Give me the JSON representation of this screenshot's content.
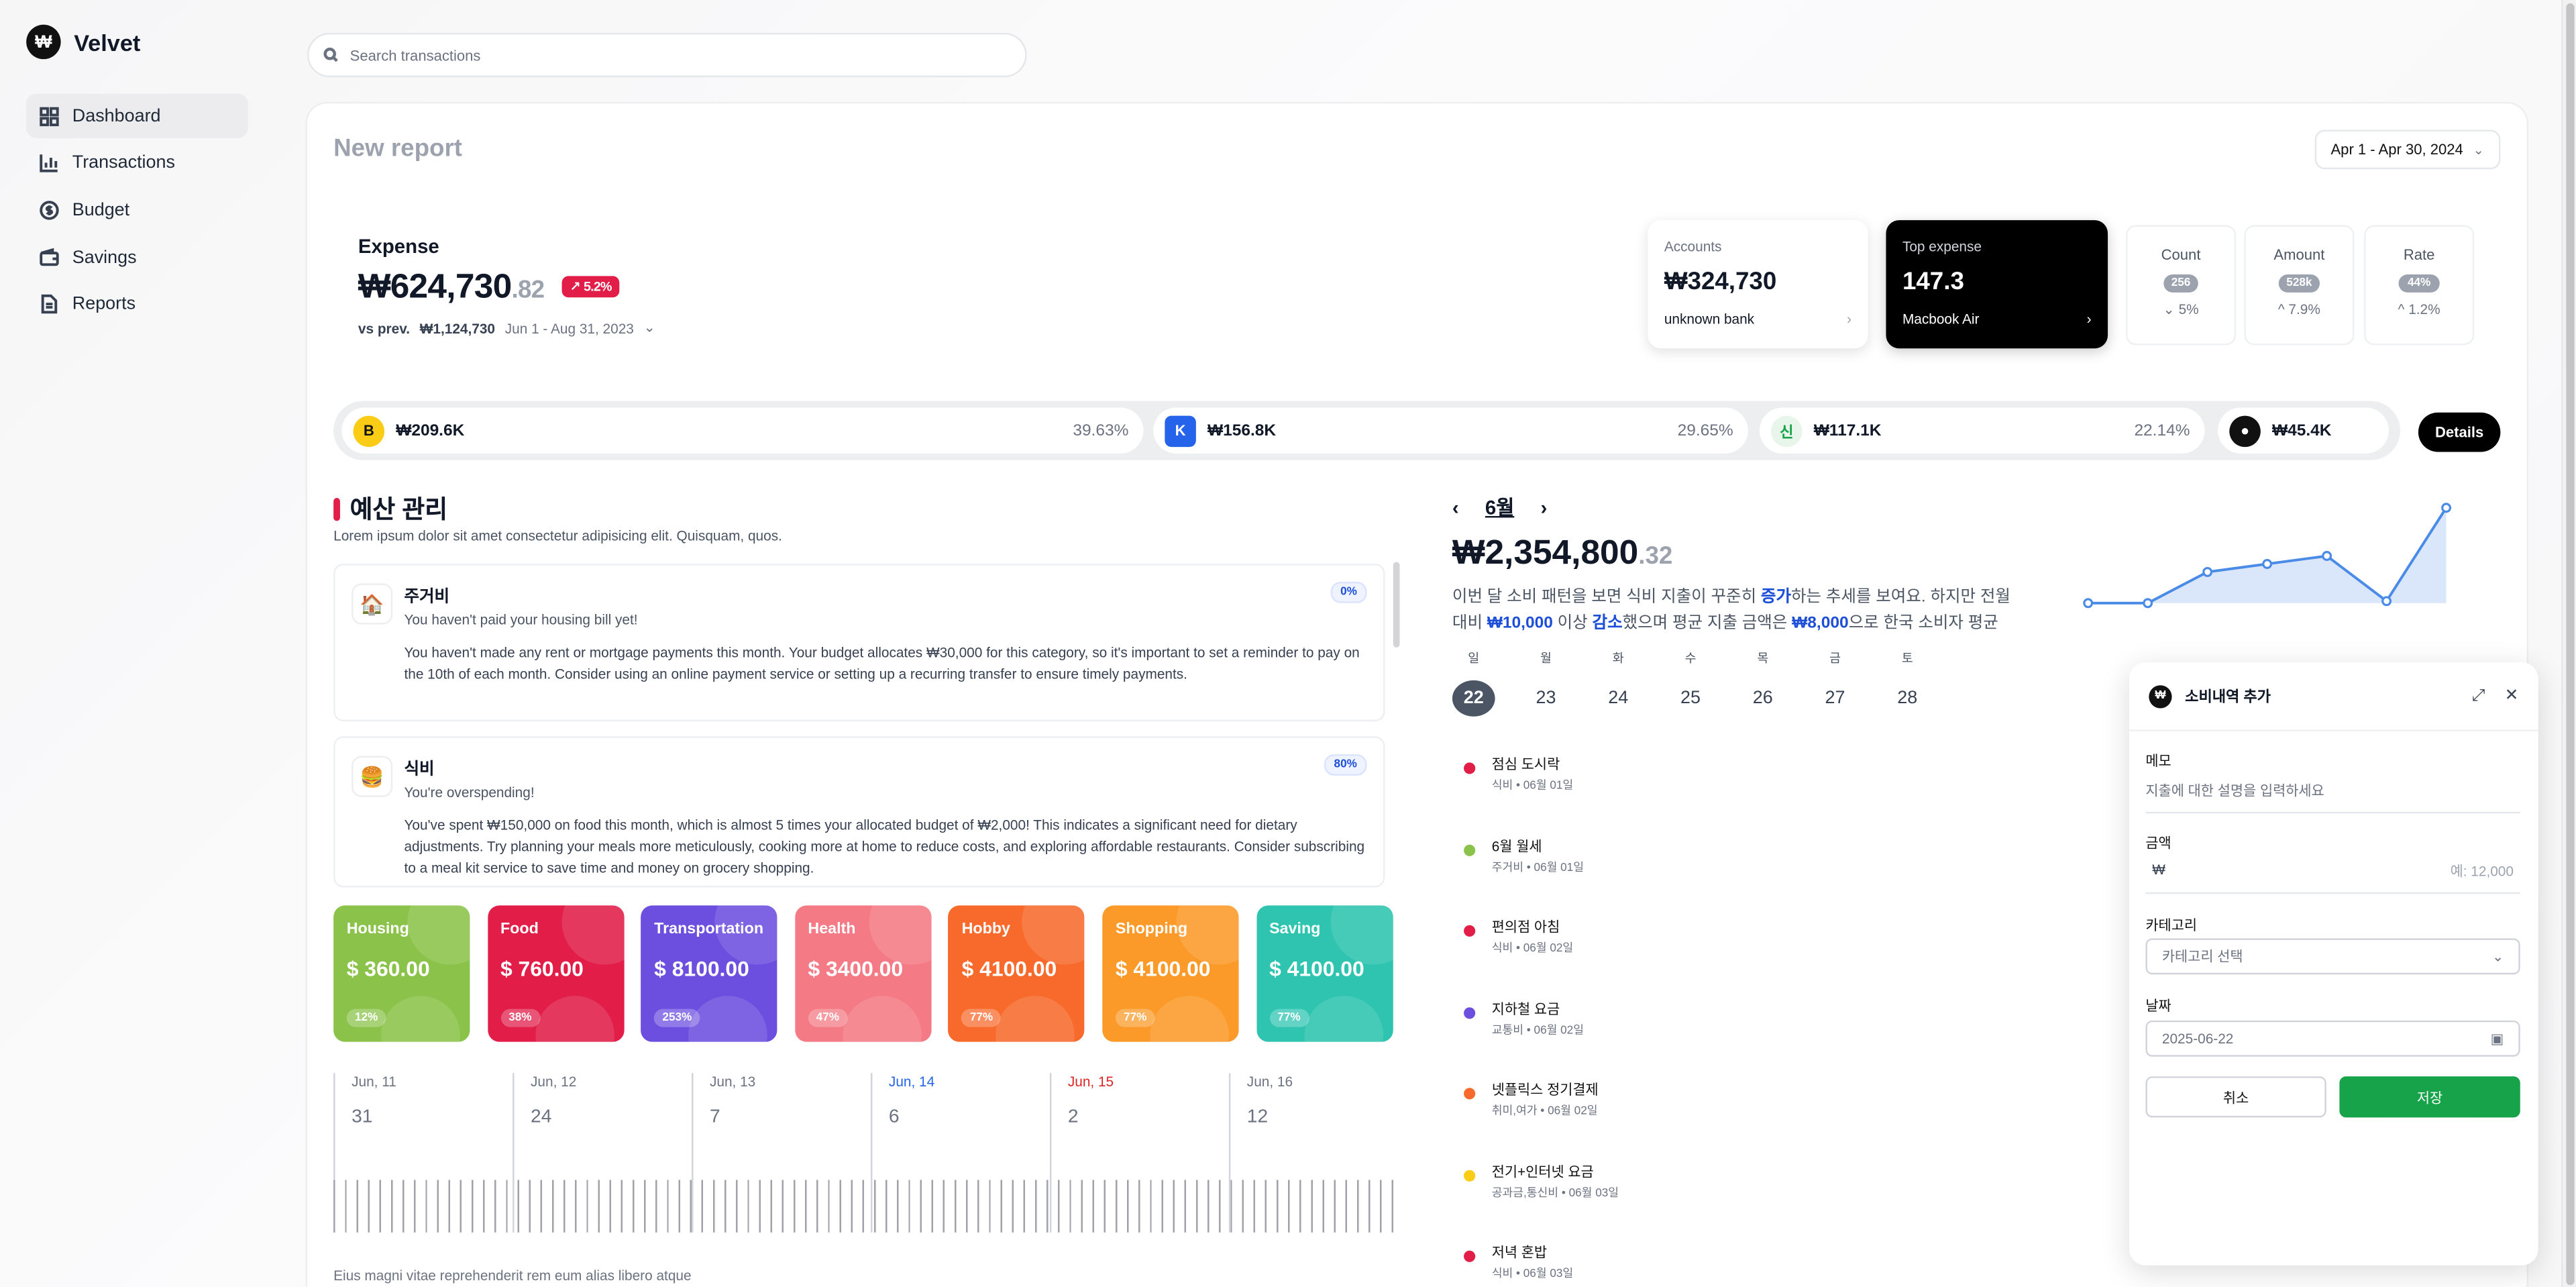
{
  "app": {
    "brand": "Velvet",
    "logo": "₩"
  },
  "sidebar": {
    "items": [
      {
        "label": "Dashboard",
        "icon": "grid-icon"
      },
      {
        "label": "Transactions",
        "icon": "bar-chart-icon"
      },
      {
        "label": "Budget",
        "icon": "dollar-circle-icon"
      },
      {
        "label": "Savings",
        "icon": "wallet-icon"
      },
      {
        "label": "Reports",
        "icon": "document-icon"
      }
    ]
  },
  "search": {
    "placeholder": "Search transactions"
  },
  "report": {
    "title": "New report",
    "date_range": "Apr 1 - Apr 30, 2024"
  },
  "expense": {
    "label": "Expense",
    "value": "₩624,730",
    "decimal": ".82",
    "change": "5.2%",
    "vs_label": "vs prev.",
    "prev_value": "₩1,124,730",
    "prev_range": "Jun 1 - Aug 31, 2023"
  },
  "accounts_card": {
    "label": "Accounts",
    "value": "₩324,730",
    "sub": "unknown bank"
  },
  "top_expense_card": {
    "label": "Top expense",
    "value": "147.3",
    "sub": "Macbook Air"
  },
  "mini_stats": [
    {
      "label": "Count",
      "pill": "256",
      "change": "5%",
      "dir": "down"
    },
    {
      "label": "Amount",
      "pill": "528k",
      "change": "7.9%",
      "dir": "up"
    },
    {
      "label": "Rate",
      "pill": "44%",
      "change": "1.2%",
      "dir": "up"
    }
  ],
  "banks": [
    {
      "value": "₩209.6K",
      "pct": "39.63%",
      "icon_text": "B",
      "color": "#facc15"
    },
    {
      "value": "₩156.8K",
      "pct": "29.65%",
      "icon_text": "K",
      "color": "#2563eb"
    },
    {
      "value": "₩117.1K",
      "pct": "22.14%",
      "icon_text": "신",
      "color": "#16a34a"
    },
    {
      "value": "₩45.4K",
      "icon_text": "●",
      "color": "#111111"
    }
  ],
  "details_button": "Details",
  "budget": {
    "title": "예산 관리",
    "subtitle": "Lorem ipsum dolor sit amet consectetur adipisicing elit. Quisquam, quos.",
    "items": [
      {
        "title": "주거비",
        "status": "You haven't paid your housing bill yet!",
        "percent": "0%",
        "icon": "house-icon",
        "body": "You haven't made any rent or mortgage payments this month. Your budget allocates ₩30,000 for this category, so it's important to set a reminder to pay on the 10th of each month. Consider using an online payment service or setting up a recurring transfer to ensure timely payments."
      },
      {
        "title": "식비",
        "status": "You're overspending!",
        "percent": "80%",
        "icon": "burger-icon",
        "body": "You've spent ₩150,000 on food this month, which is almost 5 times your allocated budget of ₩2,000! This indicates a significant need for dietary adjustments. Try planning your meals more meticulously, cooking more at home to reduce costs, and exploring affordable restaurants. Consider subscribing to a meal kit service to save time and money on grocery shopping."
      }
    ]
  },
  "tiles": [
    {
      "name": "Housing",
      "value": "$ 360.00",
      "pct": "12%",
      "color": "#8bc34a"
    },
    {
      "name": "Food",
      "value": "$ 760.00",
      "pct": "38%",
      "color": "#e11d48"
    },
    {
      "name": "Transportation",
      "value": "$ 8100.00",
      "pct": "253%",
      "color": "#6d4fe0"
    },
    {
      "name": "Health",
      "value": "$ 3400.00",
      "pct": "47%",
      "color": "#f47a85"
    },
    {
      "name": "Hobby",
      "value": "$ 4100.00",
      "pct": "77%",
      "color": "#f86a2c"
    },
    {
      "name": "Shopping",
      "value": "$ 4100.00",
      "pct": "77%",
      "color": "#fb9a28"
    },
    {
      "name": "Saving",
      "value": "$ 4100.00",
      "pct": "77%",
      "color": "#2ec4b0"
    }
  ],
  "days": [
    {
      "date": "Jun, 11",
      "count": "31",
      "color": "#6b7280"
    },
    {
      "date": "Jun, 12",
      "count": "24",
      "color": "#6b7280"
    },
    {
      "date": "Jun, 13",
      "count": "7",
      "color": "#6b7280"
    },
    {
      "date": "Jun, 14",
      "count": "6",
      "color": "#2563eb"
    },
    {
      "date": "Jun, 15",
      "count": "2",
      "color": "#dc2626"
    },
    {
      "date": "Jun, 16",
      "count": "12",
      "color": "#6b7280"
    }
  ],
  "footer_text": "Eius magni vitae reprehenderit rem eum alias libero atque",
  "calendar": {
    "month": "6월",
    "total": "₩2,354,800",
    "total_decimal": ".32",
    "desc_parts": [
      "이번 달 소비 패턴을 보면 식비 지출이 꾸준히 ",
      "증가",
      "하는 추세를 보여요. 하지만 전월 대비 ",
      "₩10,000",
      " 이상 ",
      "감소",
      "했으며 평균 지출 금액은 ",
      "₩8,000",
      "으로 한국 소비자 평균 수..."
    ],
    "weekdays": [
      "일",
      "월",
      "화",
      "수",
      "목",
      "금",
      "토"
    ],
    "dates": [
      "22",
      "23",
      "24",
      "25",
      "26",
      "27",
      "28"
    ],
    "trend": [
      0,
      0,
      3.1,
      3.9,
      4.7,
      0.2,
      9.5
    ]
  },
  "transactions": [
    {
      "title": "점심 도시락",
      "meta": "식비 • 06월 01일",
      "color": "#e11d48"
    },
    {
      "title": "6월 월세",
      "meta": "주거비 • 06월 01일",
      "color": "#8bc34a"
    },
    {
      "title": "편의점 아침",
      "meta": "식비 • 06월 02일",
      "color": "#e11d48"
    },
    {
      "title": "지하철 요금",
      "meta": "교통비 • 06월 02일",
      "color": "#6d4fe0"
    },
    {
      "title": "넷플릭스 정기결제",
      "meta": "취미,여가 • 06월 02일",
      "color": "#f86a2c"
    },
    {
      "title": "전기+인터넷 요금",
      "meta": "공과금,통신비 • 06월 03일",
      "color": "#facc15"
    },
    {
      "title": "저녁 혼밥",
      "meta": "식비 • 06월 03일",
      "color": "#e11d48"
    }
  ],
  "form": {
    "title": "소비내역 추가",
    "memo_label": "메모",
    "memo_placeholder": "지출에 대한 설명을 입력하세요",
    "amount_label": "금액",
    "currency": "₩",
    "amount_placeholder": "예: 12,000",
    "category_label": "카테고리",
    "category_value": "카테고리 선택",
    "date_label": "날짜",
    "date_value": "2025-06-22",
    "cancel": "취소",
    "save": "저장",
    "save_color": "#16a34a"
  }
}
